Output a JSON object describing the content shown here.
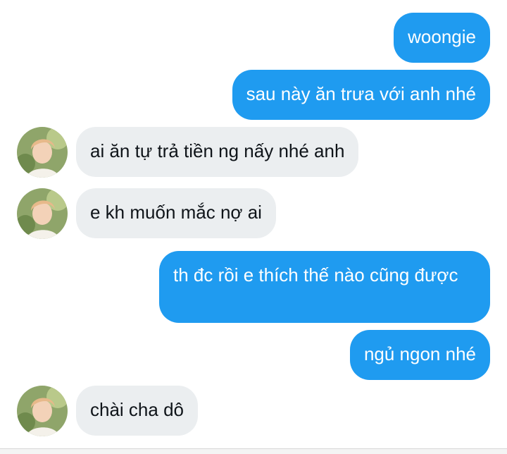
{
  "messages": [
    {
      "side": "out",
      "text": "woongie"
    },
    {
      "side": "out",
      "text": "sau này ăn trưa với anh nhé"
    },
    {
      "side": "in",
      "text": "ai ăn tự trả tiền ng nấy nhé anh",
      "avatar_icon": "user-avatar-photo"
    },
    {
      "side": "in",
      "text": "e kh muốn mắc nợ ai",
      "avatar_icon": "user-avatar-photo"
    },
    {
      "side": "out",
      "text": "th đc rồi e thích thế nào cũng được"
    },
    {
      "side": "out",
      "text": "ngủ ngon nhé"
    },
    {
      "side": "in",
      "text": "chài cha dô",
      "avatar_icon": "user-avatar-photo"
    }
  ],
  "colors": {
    "outgoing_bubble": "#1f9bf0",
    "incoming_bubble": "#ebeef0",
    "outgoing_text": "#ffffff",
    "incoming_text": "#0f1419"
  }
}
